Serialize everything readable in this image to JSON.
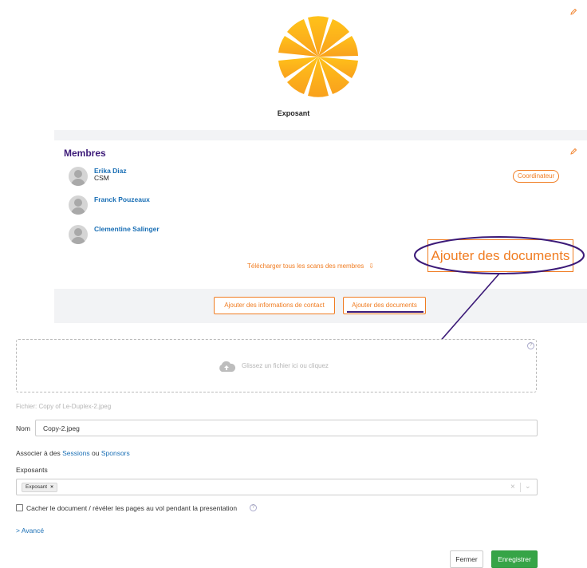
{
  "exhibitor": {
    "name": "Exposant",
    "logo_icon": "orange-slice-logo"
  },
  "members": {
    "title": "Membres",
    "list": [
      {
        "name": "Erika Diaz",
        "role": "CSM",
        "badge": "Coordinateur"
      },
      {
        "name": "Franck Pouzeaux",
        "role": ""
      },
      {
        "name": "Clementine Salinger",
        "role": ""
      }
    ],
    "download_scans_label": "Télécharger tous les scans des membres",
    "add_documents_big_label": "Ajouter des documents"
  },
  "actions": {
    "add_contact_info": "Ajouter des informations de contact",
    "add_documents": "Ajouter des documents"
  },
  "upload": {
    "dropzone_text": "Glissez un fichier ici ou cliquez",
    "file_info": "Fichier: Copy of Le-Duplex-2.jpeg",
    "name_label": "Nom",
    "name_value": "Copy-2.jpeg",
    "associate_prefix": "Associer à des",
    "associate_sessions": "Sessions",
    "associate_or": "ou",
    "associate_sponsors": "Sponsors",
    "exhibitors_label": "Exposants",
    "exhibitor_tag": "Exposant",
    "hide_document_label": "Cacher le document / révéler les pages au vol pendant la presentation",
    "hide_document_checked": false,
    "advanced_label": "> Avancé",
    "close_button": "Fermer",
    "save_button": "Enregistrer"
  },
  "colors": {
    "accent_orange": "#f07c21",
    "title_purple": "#3c1a78",
    "link_blue": "#1a6fb5",
    "save_green": "#36a447"
  }
}
